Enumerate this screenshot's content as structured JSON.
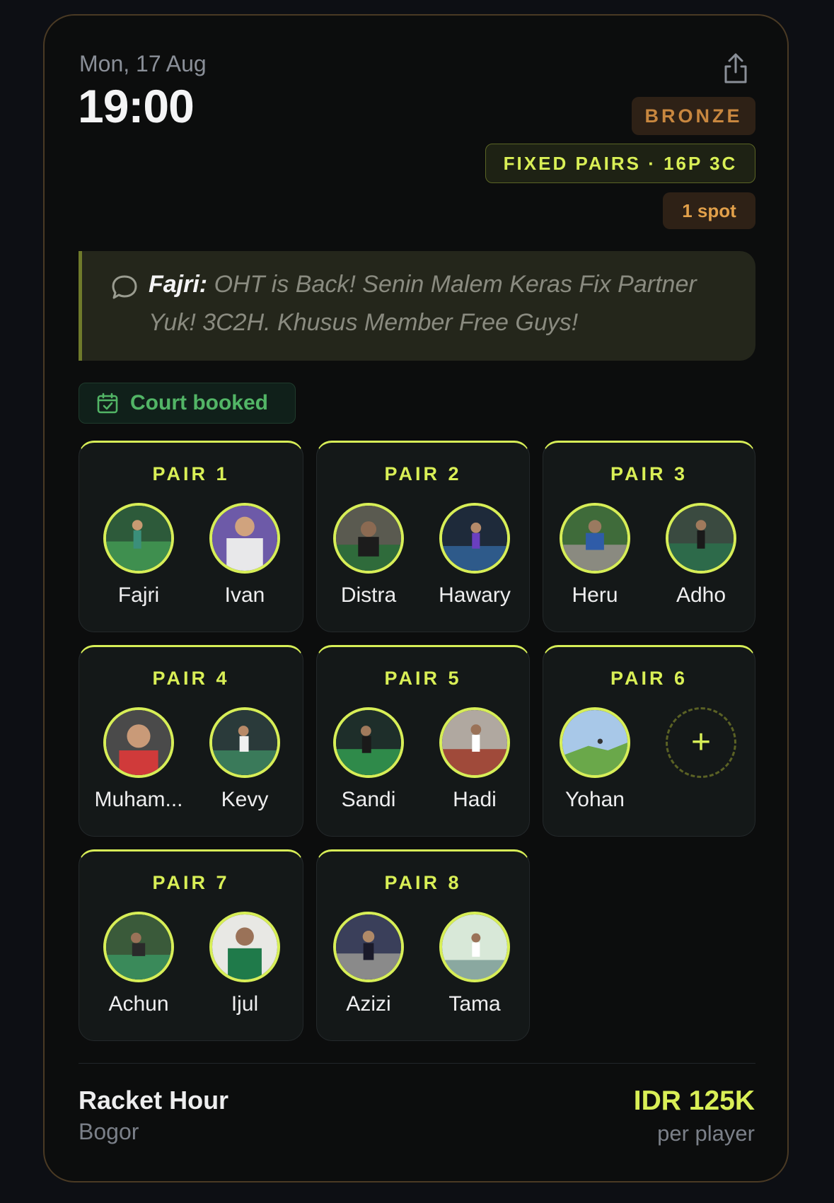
{
  "event": {
    "date": "Mon, 17 Aug",
    "time": "19:00",
    "share_icon": "share-icon"
  },
  "badges": {
    "tier": "BRONZE",
    "format": "FIXED PAIRS · 16P 3C",
    "spots": "1 spot"
  },
  "note": {
    "icon": "chat-bubble-icon",
    "author": "Fajri:",
    "text": "OHT is Back! Senin Malem Keras Fix Partner Yuk! 3C2H. Khusus Member Free Guys!"
  },
  "court_status": {
    "icon": "calendar-check-icon",
    "label": "Court booked"
  },
  "pairs": [
    {
      "label": "PAIR 1",
      "players": [
        "Fajri",
        "Ivan"
      ]
    },
    {
      "label": "PAIR 2",
      "players": [
        "Distra",
        "Hawary"
      ]
    },
    {
      "label": "PAIR 3",
      "players": [
        "Heru",
        "Adho"
      ]
    },
    {
      "label": "PAIR 4",
      "players": [
        "Muham...",
        "Kevy"
      ]
    },
    {
      "label": "PAIR 5",
      "players": [
        "Sandi",
        "Hadi"
      ]
    },
    {
      "label": "PAIR 6",
      "players": [
        "Yohan",
        ""
      ],
      "add_slot": "+"
    },
    {
      "label": "PAIR 7",
      "players": [
        "Achun",
        "Ijul"
      ]
    },
    {
      "label": "PAIR 8",
      "players": [
        "Azizi",
        "Tama"
      ]
    }
  ],
  "venue": {
    "name": "Racket Hour",
    "city": "Bogor"
  },
  "pricing": {
    "price": "IDR 125K",
    "unit": "per player"
  },
  "colors": {
    "accent": "#d9ef56",
    "bronze": "#c8873f",
    "court_green": "#52b566",
    "background": "#0c0d0d"
  }
}
